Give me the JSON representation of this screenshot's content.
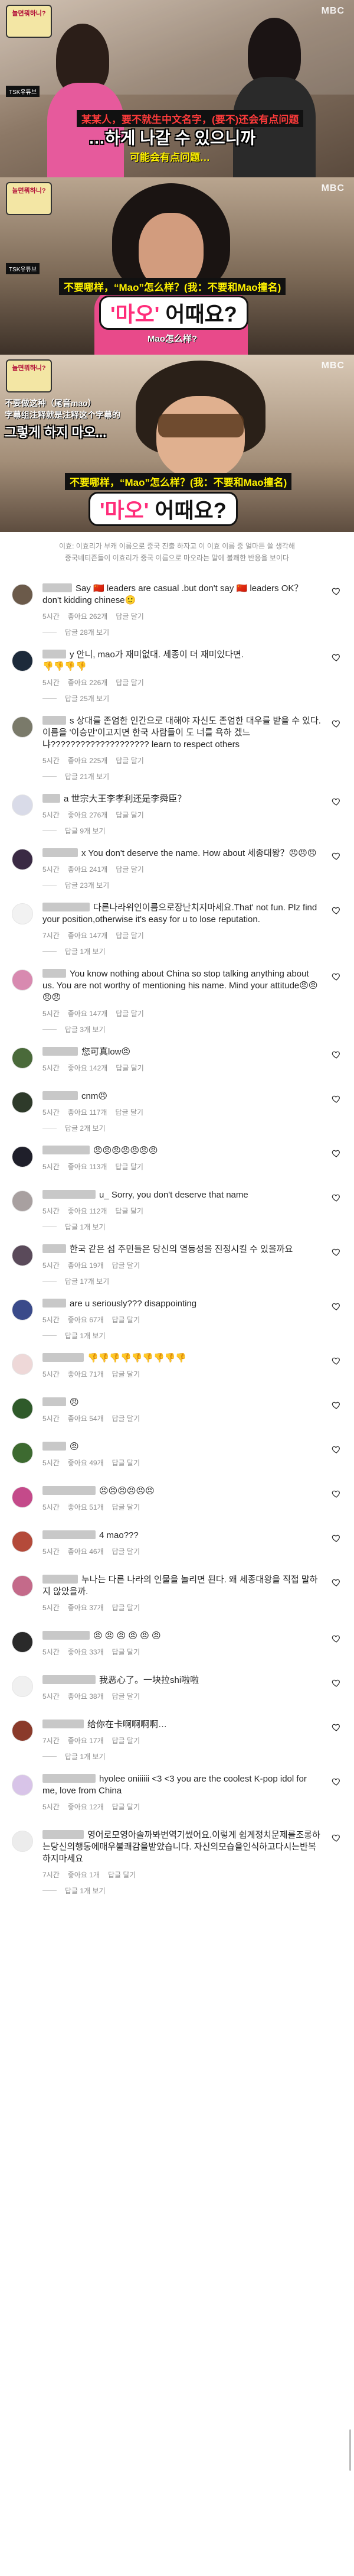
{
  "stills": {
    "frame1": {
      "logo_text": "놀면뭐하니?",
      "tsk_text": "TSK유튜브",
      "mbc": "MBC",
      "chinese_red": "某某人，要不就生中文名字，(要不)还会有点问题",
      "korean_line1": "…하게 나갈 수 있으니까",
      "chinese_yellow": "可能会有点问题…"
    },
    "frame2": {
      "logo_text": "놀면뭐하니?",
      "tsk_text": "TSK유튜브",
      "mbc": "MBC",
      "chinese_red": "不要哪样，“Mao”怎么样？(我：不要和Mao撞名)",
      "korean_box_hl": "'마오'",
      "korean_box": " 어때요?",
      "chinese_white": "Mao怎么样?"
    },
    "frame3": {
      "logo_text": "놀면뭐하니?",
      "tsk_text": "TSK유튜브",
      "mbc": "MBC",
      "chinese_top": "不要做这种（尾音mao）",
      "chinese_top2": "字幕组注释就是注释这个字幕的",
      "korean_small": "그렇게 하지 마오...",
      "chinese_red": "不要哪样，“Mao”怎么样？(我：不要和Mao撞名)",
      "korean_box_hl": "'마오'",
      "korean_box": " 어때요?"
    }
  },
  "caption": {
    "line1": "이효: 이효리가 부캐 이름으로 중국 진출 하자고 이 이효 이름 중 얼마든 쓸 생각해",
    "line2": "중국네티즌들이 이효리가 중국 이름으로 마오라는 말에 불쾌한 반응을 보이다"
  },
  "comments": [
    {
      "text": "Say 🇨🇳 leaders are casual .but don't say 🇨🇳 leaders OK？don't kidding chinese🙂",
      "time": "5시간",
      "likes": "좋아요 262개",
      "reply": "답글 달기",
      "show_replies": "답글 28개 보기"
    },
    {
      "text": "y 안니, mao가 재미없대. 세종이 더 재미있다면.",
      "emoji_line": "👎👎👎👎",
      "time": "5시간",
      "likes": "좋아요 226개",
      "reply": "답글 달기",
      "show_replies": "답글 25개 보기"
    },
    {
      "text": "s 상대를 존엄한 인간으로 대해야 자신도 존엄한 대우를 받을 수 있다. 이름을 '이승만'이고지면 한국 사람들이 도 너를 욕하 겠느냐???????????????????? learn to respect others",
      "time": "5시간",
      "likes": "좋아요 225개",
      "reply": "답글 달기",
      "show_replies": "답글 21개 보기"
    },
    {
      "text": "a 世宗大王李孝利还是李舜臣？",
      "time": "5시간",
      "likes": "좋아요 276개",
      "reply": "답글 달기",
      "show_replies": "답글 9개 보기"
    },
    {
      "text": "x You don't deserve the name. How about 세종대왕？😠😠😠",
      "time": "5시간",
      "likes": "좋아요 241개",
      "reply": "답글 달기",
      "show_replies": "답글 23개 보기"
    },
    {
      "text": "다른나라위인이름으로장난치지마세요.That' not fun. Plz find your position,otherwise it's easy for u to lose reputation.",
      "time": "7시간",
      "likes": "좋아요 147개",
      "reply": "답글 달기",
      "show_replies": "답글 1개 보기"
    },
    {
      "text": "You know nothing about China so stop talking anything about us. You are not worthy of mentioning his name. Mind your attitude😠😠😠😠",
      "time": "5시간",
      "likes": "좋아요 147개",
      "reply": "답글 달기",
      "show_replies": "답글 3개 보기"
    },
    {
      "text": "您可真low😠",
      "time": "5시간",
      "likes": "좋아요 142개",
      "reply": "답글 달기",
      "show_replies": ""
    },
    {
      "text": "cnm😠",
      "time": "5시간",
      "likes": "좋아요 117개",
      "reply": "답글 달기",
      "show_replies": "답글 2개 보기"
    },
    {
      "text": "😠😠😠😠😠😠😠",
      "time": "5시간",
      "likes": "좋아요 113개",
      "reply": "답글 달기",
      "show_replies": ""
    },
    {
      "text": "u_ Sorry, you don't deserve that name",
      "time": "5시간",
      "likes": "좋아요 112개",
      "reply": "답글 달기",
      "show_replies": "답글 1개 보기"
    },
    {
      "text": "한국 같은 섬 주민들은 당신의 열등성을 진정시킬 수 있을까요",
      "time": "5시간",
      "likes": "좋아요 19개",
      "reply": "답글 달기",
      "show_replies": "답글 17개 보기"
    },
    {
      "text": "are u seriously??? disappointing",
      "time": "5시간",
      "likes": "좋아요 67개",
      "reply": "답글 달기",
      "show_replies": "답글 1개 보기"
    },
    {
      "text": "👎👎👎👎👎👎👎👎👎",
      "time": "5시간",
      "likes": "좋아요 71개",
      "reply": "답글 달기",
      "show_replies": ""
    },
    {
      "text": "😠",
      "time": "5시간",
      "likes": "좋아요 54개",
      "reply": "답글 달기",
      "show_replies": ""
    },
    {
      "text": "😠",
      "time": "5시간",
      "likes": "좋아요 49개",
      "reply": "답글 달기",
      "show_replies": ""
    },
    {
      "text": "😠😠😠😠😠😠",
      "time": "5시간",
      "likes": "좋아요 51개",
      "reply": "답글 달기",
      "show_replies": ""
    },
    {
      "text": "4 mao???",
      "time": "5시간",
      "likes": "좋아요 46개",
      "reply": "답글 달기",
      "show_replies": ""
    },
    {
      "text": "누나는 다른 나라의 인물을 놀리면 된다. 왜 세종대왕을 직접 말하지 않았을까.",
      "time": "5시간",
      "likes": "좋아요 37개",
      "reply": "답글 달기",
      "show_replies": ""
    },
    {
      "text": "😠 😠 😠 😠 😠 😠",
      "time": "5시간",
      "likes": "좋아요 33개",
      "reply": "답글 달기",
      "show_replies": ""
    },
    {
      "text": "我恶心了。一块拉shi啦啦",
      "time": "5시간",
      "likes": "좋아요 38개",
      "reply": "답글 달기",
      "show_replies": ""
    },
    {
      "text": "给你在卡啊啊啊啊…",
      "time": "7시간",
      "likes": "좋아요 17개",
      "reply": "답글 달기",
      "show_replies": "답글 1개 보기"
    },
    {
      "text": "hyolee oniiiiii <3 <3 you are the coolest K-pop idol for me, love from China",
      "time": "5시간",
      "likes": "좋아요 12개",
      "reply": "답글 달기",
      "show_replies": ""
    },
    {
      "text": "영어로모영아솔까봐번역기썼어요.이렇게 쉽게정치문제를조롱하는당신의행동에매우불쾌감을받았습니다. 자신의모습을인식하고다시는반복하지마세요",
      "time": "7시간",
      "likes": "좋아요 1개",
      "reply": "답글 달기",
      "show_replies": "답글 1개 보기"
    }
  ]
}
